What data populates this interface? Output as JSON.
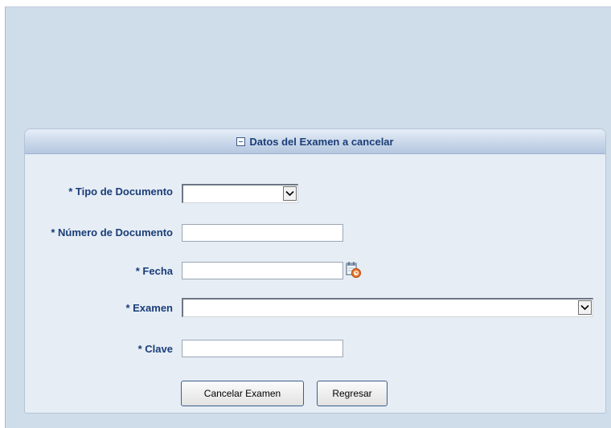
{
  "panel": {
    "title": "Datos del Examen a cancelar"
  },
  "form": {
    "tipo_documento_label": "* Tipo de Documento",
    "numero_documento_label": "* Número de Documento",
    "fecha_label": "* Fecha",
    "examen_label": "* Examen",
    "clave_label": "* Clave"
  },
  "buttons": {
    "cancelar_label": "Cancelar Examen",
    "regresar_label": "Regresar"
  },
  "icons": {
    "collapse": "minus-box-icon",
    "calendar": "calendar-icon",
    "dropdown": "chevron-down-icon"
  },
  "colors": {
    "label_text": "#1a3d78",
    "page_bg": "#cfdcea",
    "panel_bg": "#e6edf5"
  }
}
